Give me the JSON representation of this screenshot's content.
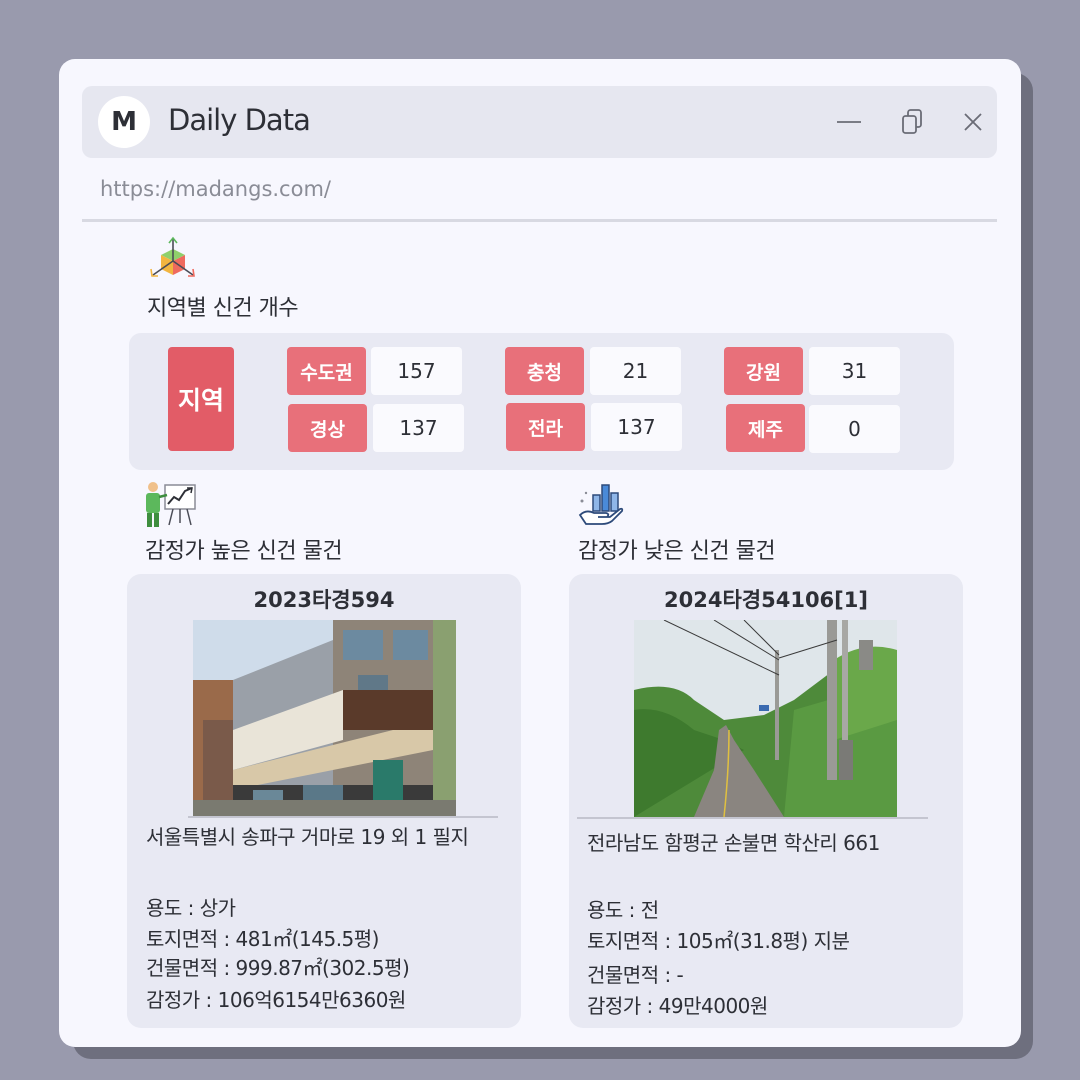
{
  "window": {
    "avatar_letter": "M",
    "title": "Daily Data",
    "url": "https://madangs.com/"
  },
  "region_section": {
    "title": "지역별 신건 개수",
    "label": "지역",
    "regions": [
      {
        "name": "수도권",
        "count": "157"
      },
      {
        "name": "충청",
        "count": "21"
      },
      {
        "name": "강원",
        "count": "31"
      },
      {
        "name": "경상",
        "count": "137"
      },
      {
        "name": "전라",
        "count": "137"
      },
      {
        "name": "제주",
        "count": "0"
      }
    ],
    "colors": {
      "label": "#e25c67",
      "badge": "#e8707a"
    }
  },
  "high_section": {
    "title": "감정가 높은 신건 물건",
    "case_no": "2023타경594",
    "address": "서울특별시 송파구 거마로 19 외 1 필지",
    "usage": "용도 : 상가",
    "land_area": "토지면적 : 481㎡(145.5평)",
    "building_area": "건물면적 : 999.87㎡(302.5평)",
    "appraisal": "감정가 : 106억6154만6360원"
  },
  "low_section": {
    "title": "감정가 낮은 신건 물건",
    "case_no": "2024타경54106[1]",
    "address": "전라남도 함평군 손불면 학산리 661",
    "usage": "용도 : 전",
    "land_area": "토지면적 : 105㎡(31.8평) 지분",
    "building_area": "건물면적 : -",
    "appraisal": "감정가 : 49만4000원"
  },
  "icons": {
    "window_buttons": [
      "minimize-icon",
      "copy-icon",
      "close-icon"
    ],
    "sections": [
      "cube-axes-icon",
      "presenter-chart-icon",
      "hand-chart-icon"
    ]
  }
}
